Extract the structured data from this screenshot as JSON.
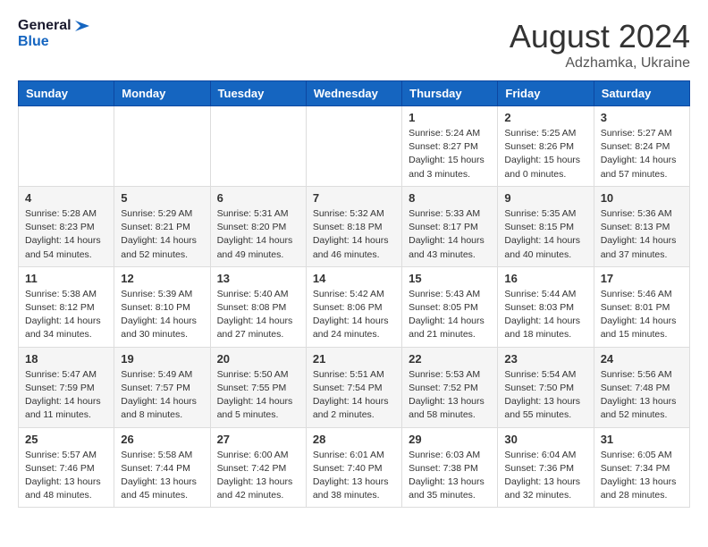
{
  "header": {
    "logo": {
      "line1": "General",
      "line2": "Blue"
    },
    "month_year": "August 2024",
    "location": "Adzhamka, Ukraine"
  },
  "weekdays": [
    "Sunday",
    "Monday",
    "Tuesday",
    "Wednesday",
    "Thursday",
    "Friday",
    "Saturday"
  ],
  "weeks": [
    [
      {
        "day": "",
        "info": ""
      },
      {
        "day": "",
        "info": ""
      },
      {
        "day": "",
        "info": ""
      },
      {
        "day": "",
        "info": ""
      },
      {
        "day": "1",
        "info": "Sunrise: 5:24 AM\nSunset: 8:27 PM\nDaylight: 15 hours\nand 3 minutes."
      },
      {
        "day": "2",
        "info": "Sunrise: 5:25 AM\nSunset: 8:26 PM\nDaylight: 15 hours\nand 0 minutes."
      },
      {
        "day": "3",
        "info": "Sunrise: 5:27 AM\nSunset: 8:24 PM\nDaylight: 14 hours\nand 57 minutes."
      }
    ],
    [
      {
        "day": "4",
        "info": "Sunrise: 5:28 AM\nSunset: 8:23 PM\nDaylight: 14 hours\nand 54 minutes."
      },
      {
        "day": "5",
        "info": "Sunrise: 5:29 AM\nSunset: 8:21 PM\nDaylight: 14 hours\nand 52 minutes."
      },
      {
        "day": "6",
        "info": "Sunrise: 5:31 AM\nSunset: 8:20 PM\nDaylight: 14 hours\nand 49 minutes."
      },
      {
        "day": "7",
        "info": "Sunrise: 5:32 AM\nSunset: 8:18 PM\nDaylight: 14 hours\nand 46 minutes."
      },
      {
        "day": "8",
        "info": "Sunrise: 5:33 AM\nSunset: 8:17 PM\nDaylight: 14 hours\nand 43 minutes."
      },
      {
        "day": "9",
        "info": "Sunrise: 5:35 AM\nSunset: 8:15 PM\nDaylight: 14 hours\nand 40 minutes."
      },
      {
        "day": "10",
        "info": "Sunrise: 5:36 AM\nSunset: 8:13 PM\nDaylight: 14 hours\nand 37 minutes."
      }
    ],
    [
      {
        "day": "11",
        "info": "Sunrise: 5:38 AM\nSunset: 8:12 PM\nDaylight: 14 hours\nand 34 minutes."
      },
      {
        "day": "12",
        "info": "Sunrise: 5:39 AM\nSunset: 8:10 PM\nDaylight: 14 hours\nand 30 minutes."
      },
      {
        "day": "13",
        "info": "Sunrise: 5:40 AM\nSunset: 8:08 PM\nDaylight: 14 hours\nand 27 minutes."
      },
      {
        "day": "14",
        "info": "Sunrise: 5:42 AM\nSunset: 8:06 PM\nDaylight: 14 hours\nand 24 minutes."
      },
      {
        "day": "15",
        "info": "Sunrise: 5:43 AM\nSunset: 8:05 PM\nDaylight: 14 hours\nand 21 minutes."
      },
      {
        "day": "16",
        "info": "Sunrise: 5:44 AM\nSunset: 8:03 PM\nDaylight: 14 hours\nand 18 minutes."
      },
      {
        "day": "17",
        "info": "Sunrise: 5:46 AM\nSunset: 8:01 PM\nDaylight: 14 hours\nand 15 minutes."
      }
    ],
    [
      {
        "day": "18",
        "info": "Sunrise: 5:47 AM\nSunset: 7:59 PM\nDaylight: 14 hours\nand 11 minutes."
      },
      {
        "day": "19",
        "info": "Sunrise: 5:49 AM\nSunset: 7:57 PM\nDaylight: 14 hours\nand 8 minutes."
      },
      {
        "day": "20",
        "info": "Sunrise: 5:50 AM\nSunset: 7:55 PM\nDaylight: 14 hours\nand 5 minutes."
      },
      {
        "day": "21",
        "info": "Sunrise: 5:51 AM\nSunset: 7:54 PM\nDaylight: 14 hours\nand 2 minutes."
      },
      {
        "day": "22",
        "info": "Sunrise: 5:53 AM\nSunset: 7:52 PM\nDaylight: 13 hours\nand 58 minutes."
      },
      {
        "day": "23",
        "info": "Sunrise: 5:54 AM\nSunset: 7:50 PM\nDaylight: 13 hours\nand 55 minutes."
      },
      {
        "day": "24",
        "info": "Sunrise: 5:56 AM\nSunset: 7:48 PM\nDaylight: 13 hours\nand 52 minutes."
      }
    ],
    [
      {
        "day": "25",
        "info": "Sunrise: 5:57 AM\nSunset: 7:46 PM\nDaylight: 13 hours\nand 48 minutes."
      },
      {
        "day": "26",
        "info": "Sunrise: 5:58 AM\nSunset: 7:44 PM\nDaylight: 13 hours\nand 45 minutes."
      },
      {
        "day": "27",
        "info": "Sunrise: 6:00 AM\nSunset: 7:42 PM\nDaylight: 13 hours\nand 42 minutes."
      },
      {
        "day": "28",
        "info": "Sunrise: 6:01 AM\nSunset: 7:40 PM\nDaylight: 13 hours\nand 38 minutes."
      },
      {
        "day": "29",
        "info": "Sunrise: 6:03 AM\nSunset: 7:38 PM\nDaylight: 13 hours\nand 35 minutes."
      },
      {
        "day": "30",
        "info": "Sunrise: 6:04 AM\nSunset: 7:36 PM\nDaylight: 13 hours\nand 32 minutes."
      },
      {
        "day": "31",
        "info": "Sunrise: 6:05 AM\nSunset: 7:34 PM\nDaylight: 13 hours\nand 28 minutes."
      }
    ]
  ]
}
